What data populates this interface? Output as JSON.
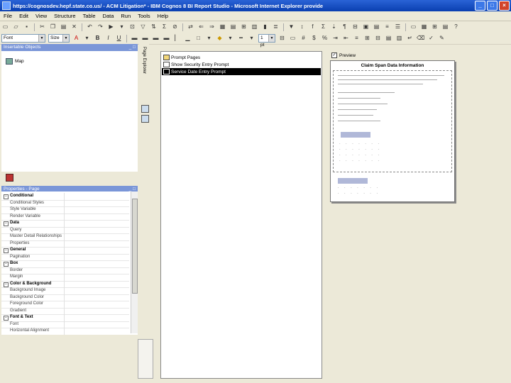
{
  "window": {
    "title": "https://cognosdev.hepf.state.co.us/ - ACM Litigation* - IBM Cognos 8 BI Report Studio - Microsoft Internet Explorer provide",
    "controls": [
      "_",
      "□",
      "×"
    ]
  },
  "menu": [
    "File",
    "Edit",
    "View",
    "Structure",
    "Table",
    "Data",
    "Run",
    "Tools",
    "Help"
  ],
  "format_bar": {
    "font_value": "Font",
    "size_value": "Size",
    "size2_value": "1 pt"
  },
  "insertable": {
    "header": "Insertable Objects",
    "header_controls": "_ □",
    "items": [
      {
        "label": "Map"
      }
    ],
    "side_label": "Page Explorer"
  },
  "properties": {
    "header": "Properties - Page",
    "header_controls": "_ □",
    "rows": [
      {
        "label": "Conditional",
        "category": true
      },
      {
        "label": "Conditional Styles",
        "category": false
      },
      {
        "label": "Style Variable",
        "category": false
      },
      {
        "label": "Render Variable",
        "category": false
      },
      {
        "label": "Data",
        "category": true
      },
      {
        "label": "Query",
        "category": false
      },
      {
        "label": "Master Detail Relationships",
        "category": false
      },
      {
        "label": "Properties",
        "category": false
      },
      {
        "label": "General",
        "category": true
      },
      {
        "label": "Pagination",
        "category": false
      },
      {
        "label": "Box",
        "category": true
      },
      {
        "label": "Border",
        "category": false
      },
      {
        "label": "Margin",
        "category": false
      },
      {
        "label": "Color & Background",
        "category": true
      },
      {
        "label": "Background Image",
        "category": false
      },
      {
        "label": "Background Color",
        "category": false
      },
      {
        "label": "Foreground Color",
        "category": false
      },
      {
        "label": "Gradient",
        "category": false
      },
      {
        "label": "Font & Text",
        "category": true
      },
      {
        "label": "Font",
        "category": false
      },
      {
        "label": "Horizontal Alignment",
        "category": false
      }
    ]
  },
  "pages": {
    "items": [
      {
        "label": "Prompt Pages",
        "selected": false
      },
      {
        "label": "Show Security Entry Prompt",
        "selected": false
      },
      {
        "label": "Service Date Entry Prompt",
        "selected": true
      }
    ]
  },
  "preview": {
    "checkbox_label": "Preview",
    "checkbox_mark": "✓",
    "title": "Claim Span Data Information"
  }
}
